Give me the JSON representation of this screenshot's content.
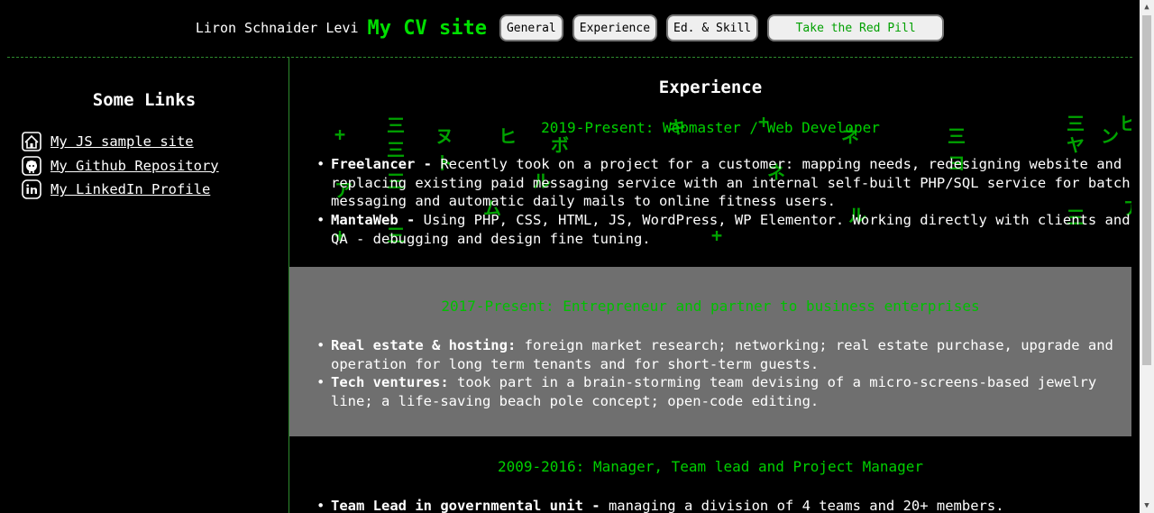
{
  "header": {
    "owner": "Liron Schnaider Levi",
    "site_title": "My CV site",
    "nav": [
      "General",
      "Experience",
      "Ed. & Skill"
    ],
    "red_pill": "Take the Red Pill"
  },
  "sidebar": {
    "title": "Some Links",
    "links": [
      {
        "label": "My JS sample site",
        "icon": "home-icon"
      },
      {
        "label": "My Github Repository",
        "icon": "github-icon"
      },
      {
        "label": "My LinkedIn Profile",
        "icon": "linkedin-icon"
      }
    ]
  },
  "main": {
    "title": "Experience",
    "jobs": [
      {
        "heading": "2019-Present: Webmaster / Web Developer",
        "items": [
          {
            "title": "Freelancer - ",
            "text": "Recently took on a project for a customer: mapping needs, redesigning website and replacing existing paid messaging service with an internal self-built PHP/SQL service for batch messaging and automatic daily mails to online fitness users."
          },
          {
            "title": "MantaWeb - ",
            "text": "Using PHP, CSS, HTML, JS, WordPress, WP Elementor. Working directly with clients and QA - debugging and design fine tuning."
          }
        ]
      },
      {
        "heading": "2017-Present: Entrepreneur and partner to business enterprises",
        "items": [
          {
            "title": "Real estate & hosting:",
            "text": " foreign market research; networking; real estate purchase, upgrade and operation for long term tenants and for short-term guests."
          },
          {
            "title": "Tech ventures:",
            "text": " took part in a brain-storming team devising of a micro-screens-based jewelry line; a life-saving beach pole concept; open-code editing."
          }
        ]
      },
      {
        "heading": "2009-2016: Manager, Team lead and Project Manager",
        "items": [
          {
            "title": "Team Lead in governmental unit - ",
            "text": "managing a division of 4 teams and 20+ members."
          }
        ]
      }
    ]
  },
  "colors": {
    "accent": "#00e000",
    "panel_gray": "#6f6f6f",
    "divider": "#2e8b2e"
  }
}
